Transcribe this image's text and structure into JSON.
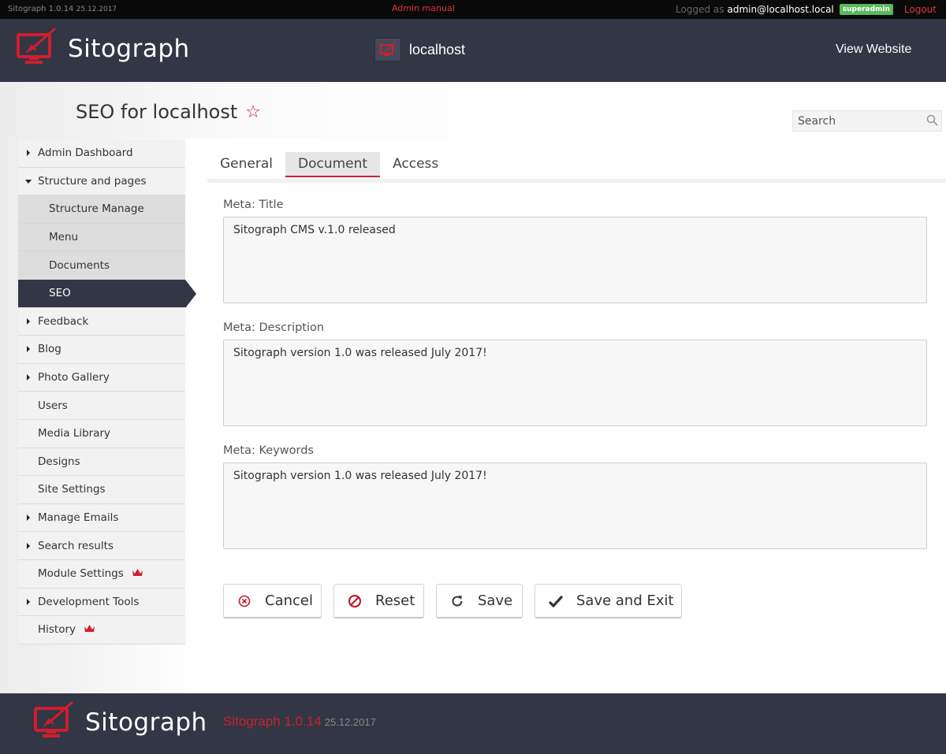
{
  "topbar": {
    "version": "Sitograph 1.0.14",
    "date": "25.12.2017",
    "manual": "Admin manual",
    "logged_as": "Logged as",
    "email": "admin@localhost.local",
    "role": "superadmin",
    "logout": "Logout"
  },
  "header": {
    "brand": "Sitograph",
    "site": "localhost",
    "view_website": "View Website"
  },
  "page": {
    "title": "SEO for localhost",
    "search_placeholder": "Search"
  },
  "sidebar": {
    "items": [
      {
        "label": "Admin Dashboard"
      },
      {
        "label": "Structure and pages"
      },
      {
        "label": "Structure Manage"
      },
      {
        "label": "Menu"
      },
      {
        "label": "Documents"
      },
      {
        "label": "SEO"
      },
      {
        "label": "Feedback"
      },
      {
        "label": "Blog"
      },
      {
        "label": "Photo Gallery"
      },
      {
        "label": "Users"
      },
      {
        "label": "Media Library"
      },
      {
        "label": "Designs"
      },
      {
        "label": "Site Settings"
      },
      {
        "label": "Manage Emails"
      },
      {
        "label": "Search results"
      },
      {
        "label": "Module Settings"
      },
      {
        "label": "Development Tools"
      },
      {
        "label": "History"
      }
    ]
  },
  "tabs": [
    "General",
    "Document",
    "Access"
  ],
  "form": {
    "title_label": "Meta: Title",
    "title_value": "Sitograph CMS v.1.0 released",
    "description_label": "Meta: Description",
    "description_value": "Sitograph version 1.0 was released July 2017!",
    "keywords_label": "Meta: Keywords",
    "keywords_value": "Sitograph version 1.0 was released July 2017!"
  },
  "buttons": {
    "cancel": "Cancel",
    "reset": "Reset",
    "save": "Save",
    "save_exit": "Save and Exit"
  },
  "footer": {
    "brand": "Sitograph",
    "version": "Sitograph 1.0.14",
    "date": "25.12.2017"
  },
  "colors": {
    "accent": "#d01e2e",
    "header_bg": "#333644",
    "badge": "#5cb85c"
  }
}
